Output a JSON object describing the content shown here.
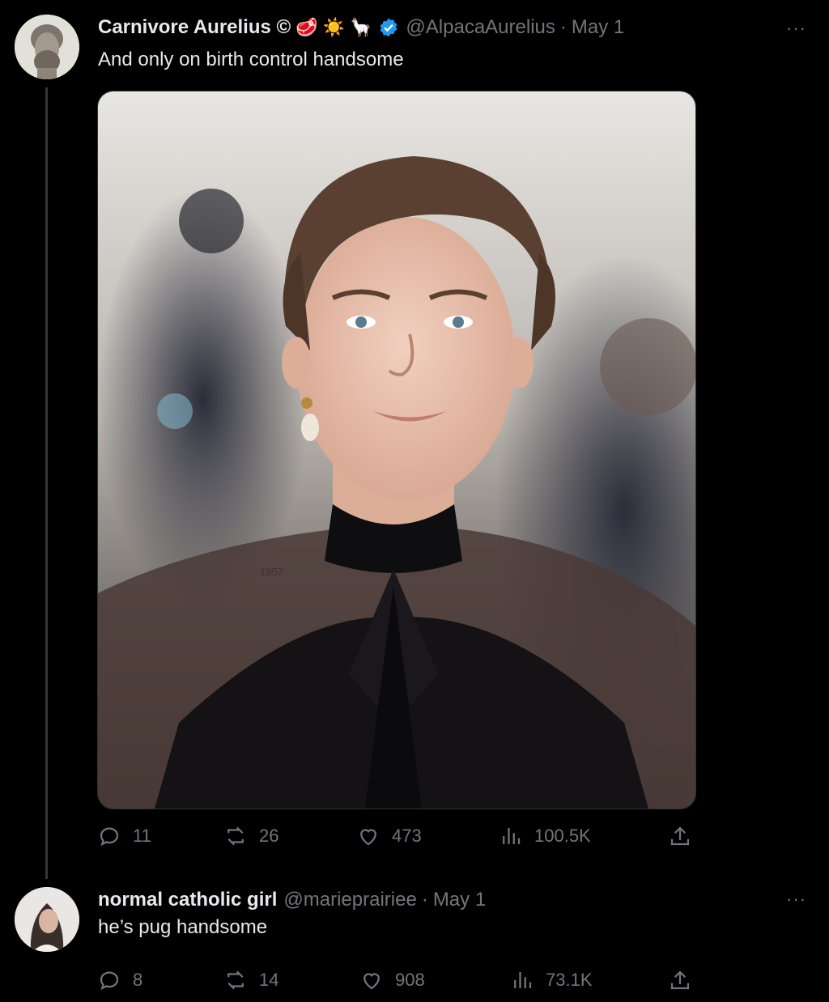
{
  "tweets": [
    {
      "author_name": "Carnivore Aurelius ©",
      "author_emojis": [
        "🥩",
        "☀️",
        "🦙"
      ],
      "handle": "@AlpacaAurelius",
      "separator": "·",
      "date": "May 1",
      "text": "And only on birth control handsome",
      "more": "···",
      "stats": {
        "replies": "11",
        "reposts": "26",
        "likes": "473",
        "views": "100.5K"
      }
    },
    {
      "author_name": "normal catholic girl",
      "handle": "@marieprairiee",
      "separator": "·",
      "date": "May 1",
      "text": "he’s pug handsome",
      "more": "···",
      "stats": {
        "replies": "8",
        "reposts": "14",
        "likes": "908",
        "views": "73.1K"
      }
    }
  ],
  "colors": {
    "background": "#000000",
    "text": "#e7e9ea",
    "muted": "#71767b",
    "verified": "#1d9bf0",
    "thread_line": "#333639"
  }
}
